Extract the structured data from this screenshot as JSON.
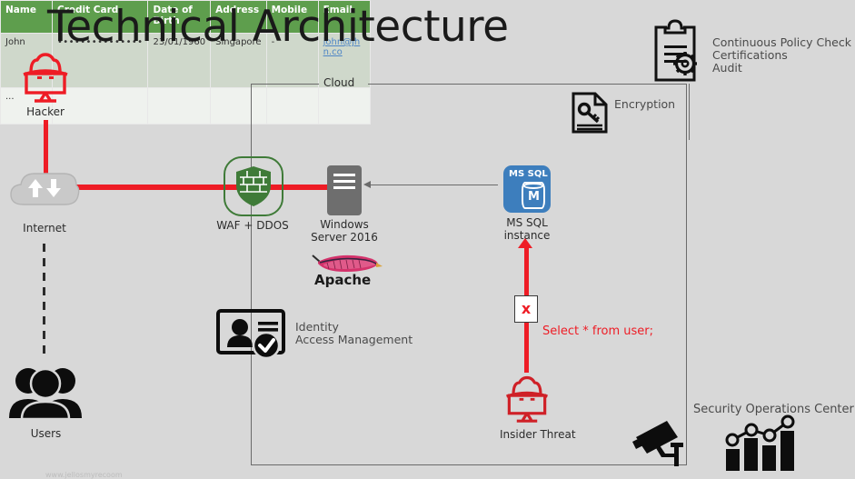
{
  "page": {
    "title": "Technical Architecture",
    "background_color": "#d8d8d8",
    "watermark": "www.jellosmyrecoom"
  },
  "boundary": {
    "label": "Cloud"
  },
  "nodes": {
    "hacker": {
      "label": "Hacker",
      "icon": "hacker-monitor-icon",
      "color": "#ee1c25"
    },
    "internet": {
      "label": "Internet",
      "icon": "cloud-updown-arrows-icon",
      "color": "#c9c9c9"
    },
    "users": {
      "label": "Users",
      "icon": "users-group-icon",
      "color": "#0d0d0d"
    },
    "waf": {
      "label": "WAF + DDOS",
      "icon": "firewall-shield-icon",
      "color": "#3f7b38"
    },
    "windows_server": {
      "label": "Windows\nServer 2016",
      "label_line1": "Windows",
      "label_line2": "Server 2016",
      "icon": "server-rack-icon",
      "color": "#6e6e6e"
    },
    "mssql": {
      "label_line1": "MS SQL",
      "label_line2": "instance",
      "badge_text": "MS SQL",
      "cylinder_letter": "M",
      "icon": "database-icon",
      "color": "#3d7ebd"
    },
    "apache": {
      "label": "Apache",
      "icon": "apache-feather-icon"
    },
    "insider_threat": {
      "label": "Insider Threat",
      "icon": "hacker-monitor-icon",
      "color": "#cf2027"
    }
  },
  "annotations": {
    "policy": {
      "icon": "clipboard-gear-icon",
      "lines": [
        "Continuous Policy Check",
        "Certifications",
        "Audit"
      ]
    },
    "encryption": {
      "icon": "document-key-icon",
      "label": "Encryption"
    },
    "iam": {
      "icon": "id-card-check-icon",
      "line1": "Identity",
      "line2": "Access Management"
    },
    "soc": {
      "icon": "cctv-camera-icon",
      "chart_icon": "bar-chart-line-icon",
      "label": "Security Operations Center"
    },
    "sql_injection": {
      "marker": "x",
      "query": "Select * from user;",
      "color": "#ee1c25"
    }
  },
  "table": {
    "header_color": "#5e9e4d",
    "columns": [
      "Name",
      "Credit Card",
      "Date of Birth",
      "Address",
      "Mobile",
      "Email"
    ],
    "rows": [
      {
        "name": "John",
        "credit_card": "•••••••••••••••",
        "dob": "23/01/1960",
        "address": "Singapore",
        "mobile": "-",
        "email": "john@jhn.co"
      },
      {
        "name": "...",
        "credit_card": "",
        "dob": "",
        "address": "",
        "mobile": "",
        "email": ""
      }
    ]
  }
}
